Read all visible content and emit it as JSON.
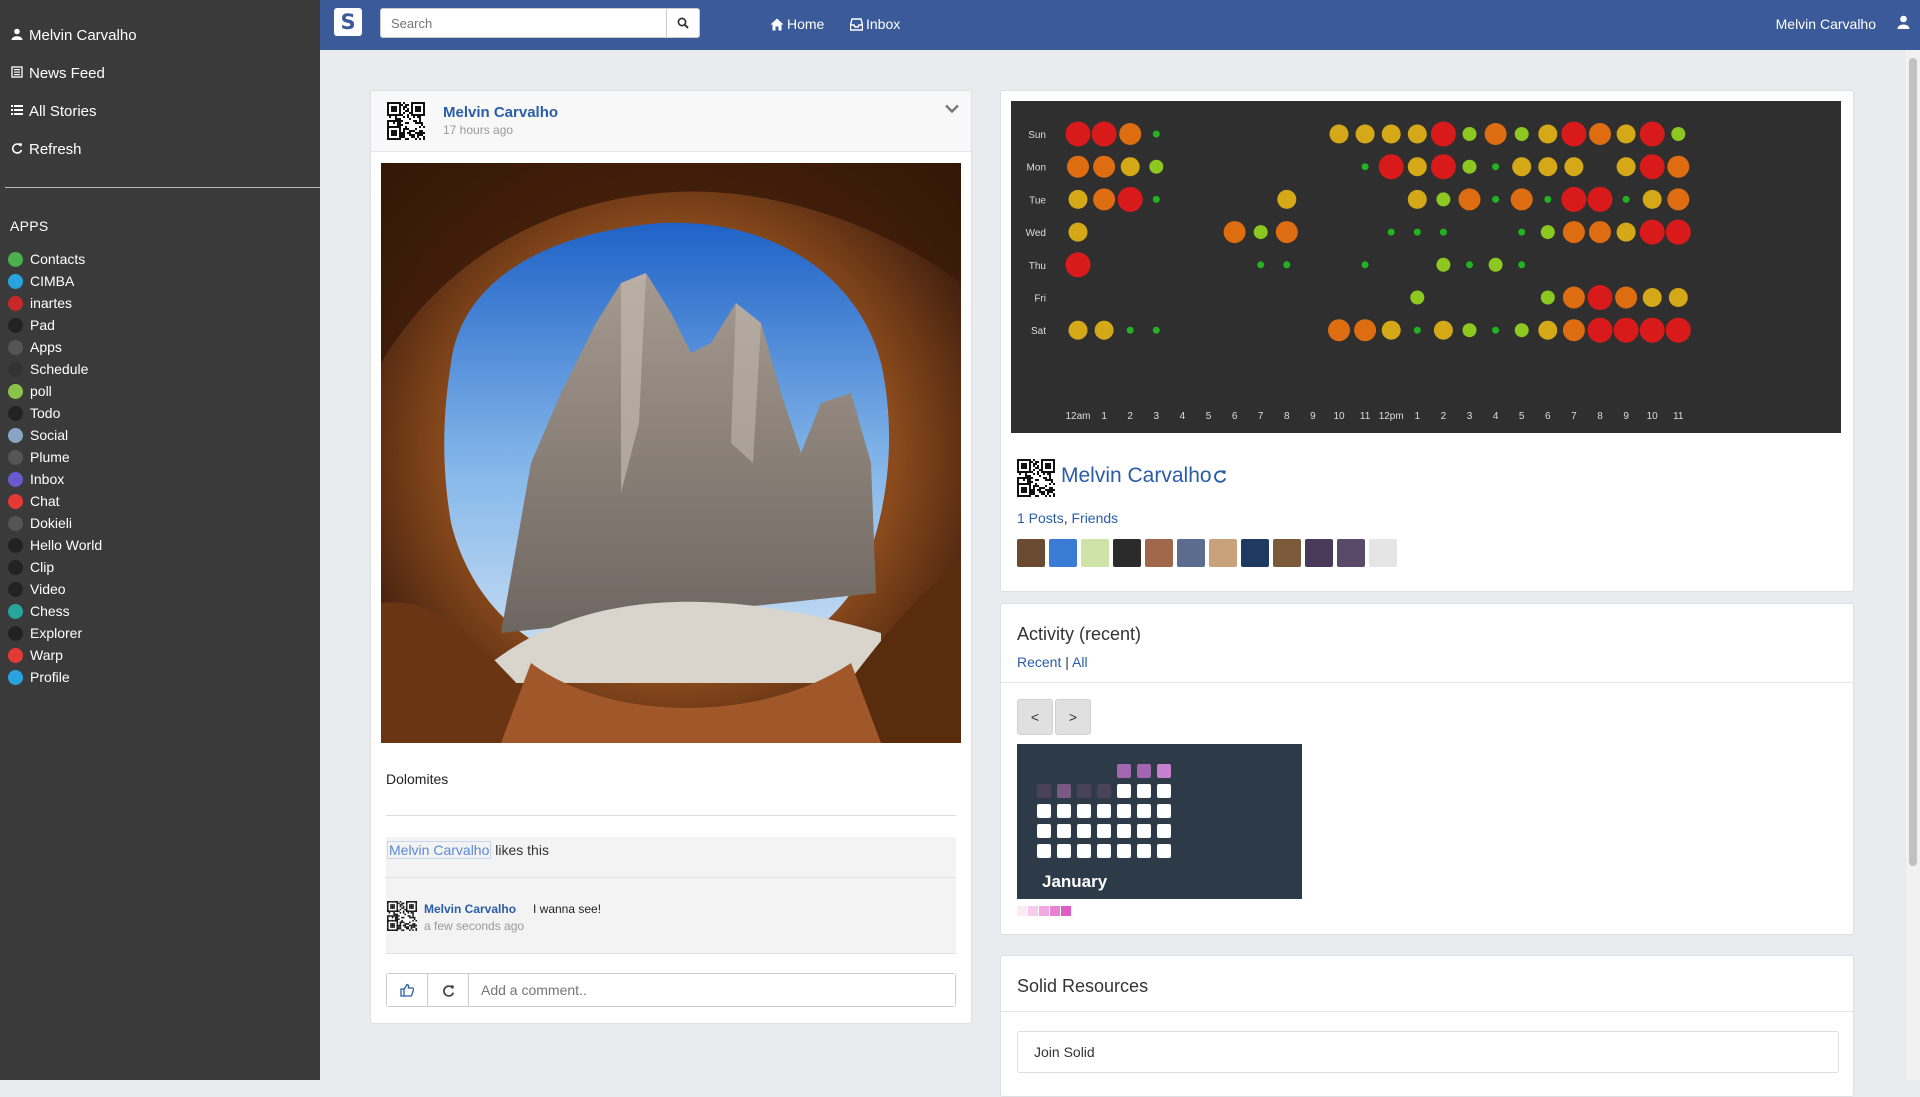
{
  "sidebar": {
    "nav": [
      {
        "label": "Melvin Carvalho",
        "icon": "user-icon"
      },
      {
        "label": "News Feed",
        "icon": "newspaper-icon"
      },
      {
        "label": "All Stories",
        "icon": "list-icon"
      },
      {
        "label": "Refresh",
        "icon": "refresh-icon"
      }
    ],
    "apps_heading": "APPS",
    "apps": [
      {
        "label": "Contacts",
        "color": "#4caf50"
      },
      {
        "label": "CIMBA",
        "color": "#29a3e0"
      },
      {
        "label": "inartes",
        "color": "#c62828"
      },
      {
        "label": "Pad",
        "color": "#222222"
      },
      {
        "label": "Apps",
        "color": "#555555"
      },
      {
        "label": "Schedule",
        "color": "#333333"
      },
      {
        "label": "poll",
        "color": "#8bc34a"
      },
      {
        "label": "Todo",
        "color": "#222222"
      },
      {
        "label": "Social",
        "color": "#8aa4c8"
      },
      {
        "label": "Plume",
        "color": "#555555"
      },
      {
        "label": "Inbox",
        "color": "#6a5acd"
      },
      {
        "label": "Chat",
        "color": "#e53935"
      },
      {
        "label": "Dokieli",
        "color": "#555555"
      },
      {
        "label": "Hello World",
        "color": "#222222"
      },
      {
        "label": "Clip",
        "color": "#222222"
      },
      {
        "label": "Video",
        "color": "#222222"
      },
      {
        "label": "Chess",
        "color": "#26a69a"
      },
      {
        "label": "Explorer",
        "color": "#222222"
      },
      {
        "label": "Warp",
        "color": "#e53935"
      },
      {
        "label": "Profile",
        "color": "#29a3e0"
      }
    ]
  },
  "navbar": {
    "brand": "S",
    "search_placeholder": "Search",
    "home_label": "Home",
    "inbox_label": "Inbox",
    "user_label": "Melvin Carvalho"
  },
  "post": {
    "author": "Melvin Carvalho",
    "time": "17 hours ago",
    "text": "Dolomites",
    "likes_name": "Melvin Carvalho",
    "likes_suffix": " likes this",
    "comment": {
      "author": "Melvin Carvalho",
      "text": " I wanna see!",
      "time": "a few seconds ago"
    },
    "comment_placeholder": "Add a comment.."
  },
  "profile": {
    "name": "Melvin Carvalho",
    "posts_label": "1 Posts",
    "friends_label": "Friends",
    "friend_count": 12
  },
  "activity": {
    "title": "Activity (recent)",
    "tab_recent": "Recent",
    "tab_all": "All",
    "prev_label": "<",
    "next_label": ">",
    "month": "January"
  },
  "resources": {
    "title": "Solid Resources",
    "join_label": "Join Solid"
  },
  "chart_data": {
    "type": "heatmap",
    "rows": [
      "Sun",
      "Mon",
      "Tue",
      "Wed",
      "Thu",
      "Fri",
      "Sat"
    ],
    "columns": [
      "12am",
      "1",
      "2",
      "3",
      "4",
      "5",
      "6",
      "7",
      "8",
      "9",
      "10",
      "11",
      "12pm",
      "1",
      "2",
      "3",
      "4",
      "5",
      "6",
      "7",
      "8",
      "9",
      "10",
      "11"
    ],
    "values": [
      [
        5,
        5,
        4,
        1,
        0,
        0,
        0,
        0,
        0,
        0,
        3,
        3,
        3,
        3,
        5,
        2,
        4,
        2,
        3,
        5,
        4,
        3,
        5,
        2
      ],
      [
        4,
        4,
        3,
        2,
        0,
        0,
        0,
        0,
        0,
        0,
        0,
        1,
        5,
        3,
        5,
        2,
        1,
        3,
        3,
        3,
        0,
        3,
        5,
        4
      ],
      [
        3,
        4,
        5,
        1,
        0,
        0,
        0,
        0,
        3,
        0,
        0,
        0,
        0,
        3,
        2,
        4,
        1,
        4,
        1,
        5,
        5,
        1,
        3,
        4
      ],
      [
        3,
        0,
        0,
        0,
        0,
        0,
        4,
        2,
        4,
        0,
        0,
        0,
        1,
        1,
        1,
        0,
        0,
        1,
        2,
        4,
        4,
        3,
        5,
        5
      ],
      [
        5,
        0,
        0,
        0,
        0,
        0,
        0,
        1,
        1,
        0,
        0,
        1,
        0,
        0,
        2,
        1,
        2,
        1,
        0,
        0,
        0,
        0,
        0,
        0
      ],
      [
        0,
        0,
        0,
        0,
        0,
        0,
        0,
        0,
        0,
        0,
        0,
        0,
        0,
        2,
        0,
        0,
        0,
        0,
        2,
        4,
        5,
        4,
        3,
        3
      ],
      [
        3,
        3,
        1,
        1,
        0,
        0,
        0,
        0,
        0,
        0,
        4,
        4,
        3,
        1,
        3,
        2,
        1,
        2,
        3,
        4,
        5,
        5,
        5,
        5
      ]
    ],
    "scale": "0 none, 1 small green, 2 yellow-green, 3 mustard, 4 orange, 5 red",
    "colors": [
      "#2f2f2f",
      "#22b222",
      "#8cc820",
      "#d4a817",
      "#dd6d10",
      "#d81a1a"
    ]
  },
  "calendar_data": {
    "cells": [
      [
        0,
        0,
        0,
        0,
        3,
        3,
        4
      ],
      [
        1,
        2,
        1,
        1,
        5,
        5,
        5
      ],
      [
        5,
        5,
        5,
        5,
        5,
        5,
        5
      ],
      [
        5,
        5,
        5,
        5,
        5,
        5,
        5
      ],
      [
        5,
        5,
        5,
        5,
        5,
        5,
        5
      ]
    ],
    "legend_colors": [
      "#fbe9f6",
      "#f5cbea",
      "#f0a8df",
      "#e982d2",
      "#df5cc4"
    ]
  }
}
